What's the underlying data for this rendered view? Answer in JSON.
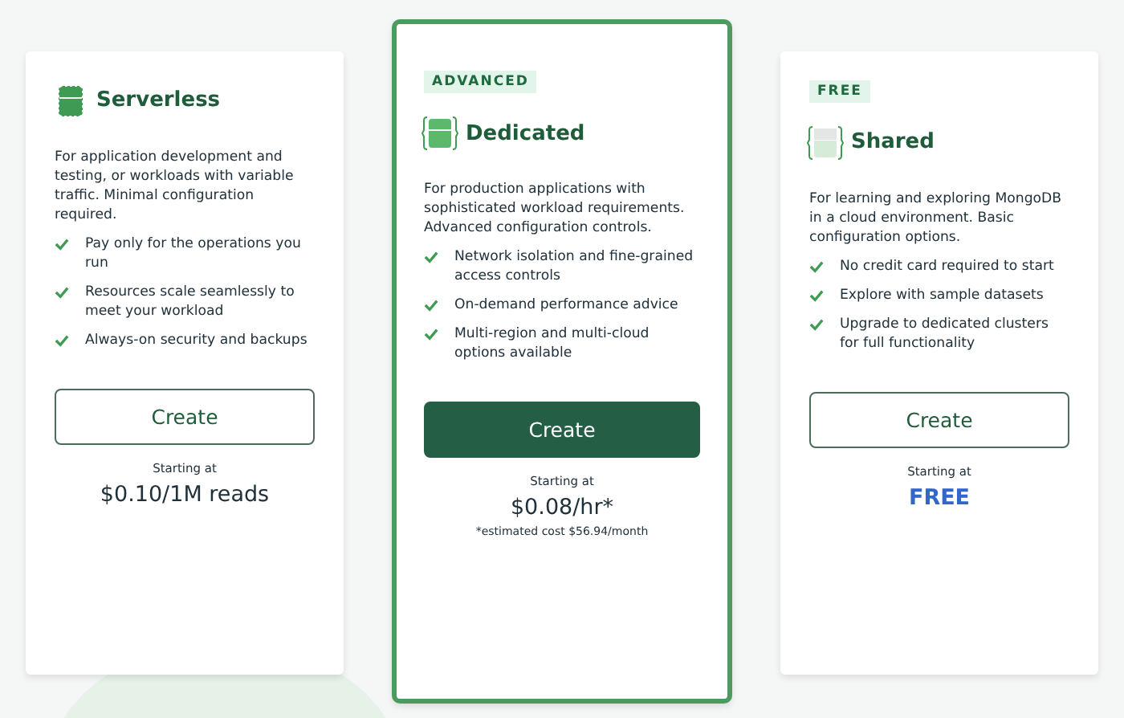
{
  "plans": [
    {
      "name": "Serverless",
      "kind": "serverless",
      "selected": false,
      "description": "For application development and testing, or workloads with variable traffic. Minimal configuration required.",
      "features": [
        "Pay only for the operations you run",
        "Resources scale seamlessly to meet your workload",
        "Always-on security and backups"
      ],
      "button": "Create",
      "starting": "Starting at",
      "price": "$0.10/1M reads",
      "price_highlight": false
    },
    {
      "badge": "ADVANCED",
      "name": "Dedicated",
      "kind": "dedicated",
      "selected": true,
      "description": "For production applications with sophisticated workload requirements. Advanced configuration controls.",
      "features": [
        "Network isolation and fine-grained access controls",
        "On-demand performance advice",
        "Multi-region and multi-cloud options available"
      ],
      "button": "Create",
      "starting": "Starting at",
      "price": "$0.08/hr*",
      "price_highlight": false,
      "note": "*estimated cost $56.94/month"
    },
    {
      "badge": "FREE",
      "name": "Shared",
      "kind": "shared",
      "selected": false,
      "description": "For learning and exploring MongoDB in a cloud environment. Basic configuration options.",
      "features": [
        "No credit card required to start",
        "Explore with sample datasets",
        "Upgrade to dedicated clusters for full functionality"
      ],
      "button": "Create",
      "starting": "Starting at",
      "price": "FREE",
      "price_highlight": true
    }
  ]
}
